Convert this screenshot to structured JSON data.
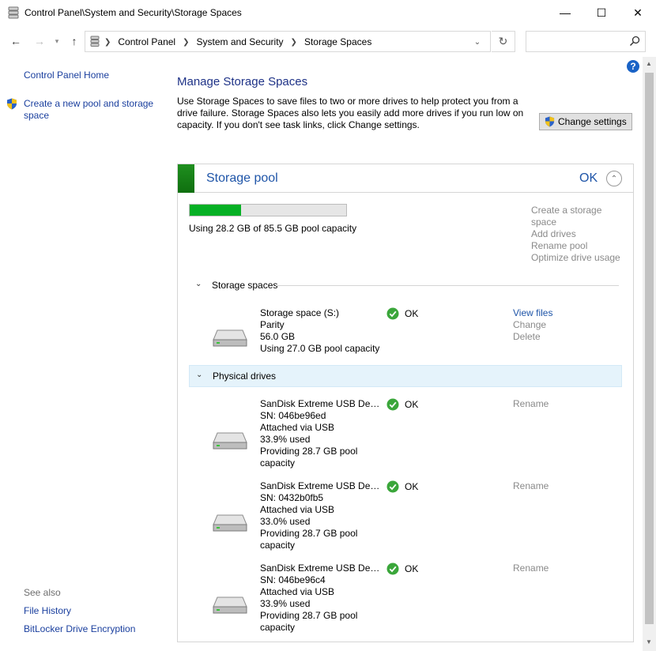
{
  "window": {
    "title": "Control Panel\\System and Security\\Storage Spaces",
    "controls": {
      "minimize": "—",
      "maximize": "☐",
      "close": "✕"
    }
  },
  "nav": {
    "back": "←",
    "forward": "→",
    "recent": "▾",
    "up": "↑",
    "breadcrumbs": [
      "Control Panel",
      "System and Security",
      "Storage Spaces"
    ],
    "dropdown": "⌄",
    "refresh": "↻",
    "search_placeholder": ""
  },
  "help": "?",
  "left_pane": {
    "home": "Control Panel Home",
    "create_pool": "Create a new pool and storage space",
    "see_also": "See also",
    "links": [
      "File History",
      "BitLocker Drive Encryption"
    ]
  },
  "main": {
    "title": "Manage Storage Spaces",
    "description": "Use Storage Spaces to save files to two or more drives to help protect you from a drive failure. Storage Spaces also lets you easily add more drives if you run low on capacity. If you don't see task links, click Change settings.",
    "change_settings": "Change settings"
  },
  "pool": {
    "name": "Storage pool",
    "status": "OK",
    "collapse": "⌃",
    "usage_fraction": 0.33,
    "usage_text": "Using 28.2 GB of 85.5 GB pool capacity",
    "tasks": [
      "Create a storage space",
      "Add drives",
      "Rename pool",
      "Optimize drive usage"
    ],
    "colors": {
      "accent": "#1f55a8",
      "usage_fill": "#06b025",
      "stripe": "#1a861a"
    }
  },
  "storage_spaces": {
    "header": "Storage spaces",
    "chevron": "⌄",
    "items": [
      {
        "lines": [
          "Storage space (S:)",
          "Parity",
          "56.0 GB",
          "Using 27.0 GB pool capacity"
        ],
        "status": "OK",
        "actions": [
          "View files",
          "Change",
          "Delete"
        ]
      }
    ]
  },
  "physical_drives": {
    "header": "Physical drives",
    "chevron": "⌄",
    "items": [
      {
        "lines": [
          "SanDisk Extreme USB Devi...",
          "SN: 046be96ed",
          "Attached via USB",
          "33.9% used",
          "Providing 28.7 GB pool capacity"
        ],
        "status": "OK",
        "action": "Rename"
      },
      {
        "lines": [
          "SanDisk Extreme USB Devi...",
          "SN: 0432b0fb5",
          "Attached via USB",
          "33.0% used",
          "Providing 28.7 GB pool capacity"
        ],
        "status": "OK",
        "action": "Rename"
      },
      {
        "lines": [
          "SanDisk Extreme USB Devi...",
          "SN: 046be96c4",
          "Attached via USB",
          "33.9% used",
          "Providing 28.7 GB pool capacity"
        ],
        "status": "OK",
        "action": "Rename"
      }
    ]
  }
}
